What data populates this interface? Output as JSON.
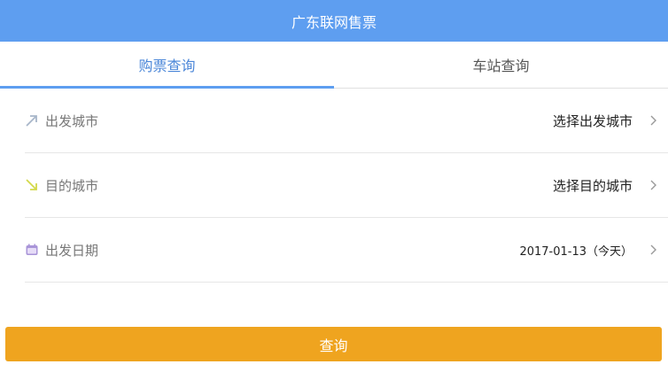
{
  "header": {
    "title": "广东联网售票"
  },
  "tabs": [
    {
      "label": "购票查询",
      "active": true
    },
    {
      "label": "车站查询",
      "active": false
    }
  ],
  "form": {
    "departure": {
      "icon": "arrow-up-right-icon",
      "label": "出发城市",
      "value": "选择出发城市"
    },
    "destination": {
      "icon": "arrow-down-right-icon",
      "label": "目的城市",
      "value": "选择目的城市"
    },
    "date": {
      "icon": "calendar-icon",
      "label": "出发日期",
      "value": "2017-01-13（今天）"
    }
  },
  "submit": {
    "label": "查询"
  },
  "colors": {
    "header_bg": "#5e9ef0",
    "active_tab": "#4a86d8",
    "submit_bg": "#efa41f",
    "departure_icon": "#a7b6c9",
    "destination_icon": "#d3d94a",
    "calendar_icon": "#a995d8"
  }
}
